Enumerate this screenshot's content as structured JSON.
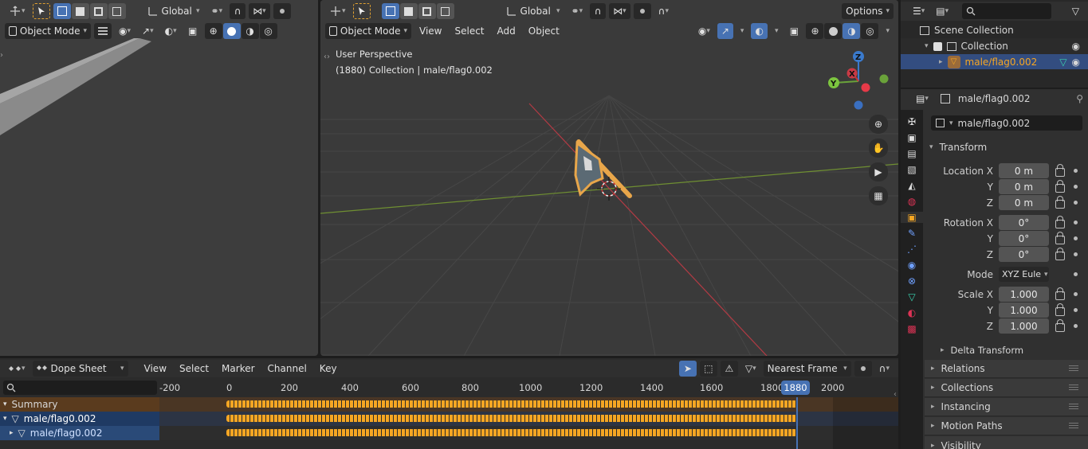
{
  "left_viewport": {
    "mode": "Object Mode",
    "orientation": "Global"
  },
  "main_viewport": {
    "mode": "Object Mode",
    "orientation": "Global",
    "menus": [
      "View",
      "Select",
      "Add",
      "Object"
    ],
    "options_label": "Options",
    "overlay_line1": "User Perspective",
    "overlay_line2": "(1880) Collection | male/flag0.002",
    "gizmo": {
      "z": "Z",
      "y": "Y",
      "x": "X"
    }
  },
  "outliner": {
    "scene_collection": "Scene Collection",
    "collection": "Collection",
    "object": "male/flag0.002"
  },
  "properties": {
    "object_name": "male/flag0.002",
    "data_name": "male/flag0.002",
    "transform_title": "Transform",
    "location_label": "Location X",
    "rotation_label": "Rotation X",
    "scale_label": "Scale X",
    "y_label": "Y",
    "z_label": "Z",
    "location": [
      "0 m",
      "0 m",
      "0 m"
    ],
    "rotation": [
      "0°",
      "0°",
      "0°"
    ],
    "mode_label": "Mode",
    "mode_value": "XYZ Eule",
    "scale": [
      "1.000",
      "1.000",
      "1.000"
    ],
    "delta_transform": "Delta Transform",
    "sections": [
      "Relations",
      "Collections",
      "Instancing",
      "Motion Paths",
      "Visibility"
    ]
  },
  "dopesheet": {
    "editor": "Dope Sheet",
    "menus": [
      "View",
      "Select",
      "Marker",
      "Channel",
      "Key"
    ],
    "snap": "Nearest Frame",
    "current_frame": "1880",
    "ticks": [
      "-200",
      "0",
      "200",
      "400",
      "600",
      "800",
      "1000",
      "1200",
      "1400",
      "1600",
      "1800",
      "2000"
    ],
    "channels": [
      "Summary",
      "male/flag0.002",
      "male/flag0.002"
    ]
  },
  "colors": {
    "accent": "#4772b3",
    "key_orange": "#f5a623",
    "x_axis": "#c83b48",
    "y_axis": "#7a9a3a"
  }
}
